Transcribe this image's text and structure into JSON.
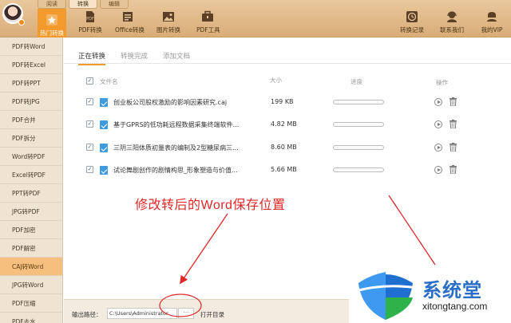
{
  "mode_tabs": [
    "阅读",
    "转换",
    "编辑"
  ],
  "toolbar": {
    "hot": "热门转换",
    "pdf": "PDF转换",
    "office": "Office转换",
    "image": "图片转换",
    "pdftools": "PDF工具",
    "history": "转换记录",
    "contact": "联系我们",
    "vip": "我的VIP"
  },
  "sidebar": [
    "PDF转Word",
    "PDF转Excel",
    "PDF转PPT",
    "PDF转JPG",
    "PDF合并",
    "PDF拆分",
    "Word转PDF",
    "Excel转PDF",
    "PPT转PDF",
    "JPG转PDF",
    "PDF加密",
    "PDF解密",
    "CAJ转Word",
    "JPG转Word",
    "PDF压缩",
    "PDF去水"
  ],
  "sidebar_active": "CAJ转Word",
  "subtabs": [
    "正在转换",
    "转换完成",
    "添加文档"
  ],
  "table": {
    "headers": {
      "name": "文件名",
      "size": "大小",
      "progress": "进度",
      "action": "操作"
    },
    "rows": [
      {
        "name": "创业板公司股权激励的影响因素研究.caj",
        "size": "199 KB",
        "progress": 0
      },
      {
        "name": "基于GPRS的低功耗远程数据采集终端软件...",
        "size": "4.82 MB",
        "progress": 0
      },
      {
        "name": "三阴三阳体质初量表的编制及2型糖尿病三...",
        "size": "8.60 MB",
        "progress": 0
      },
      {
        "name": "试论舞剧创作的剧情构思_形象塑造与价值...",
        "size": "5.66 MB",
        "progress": 0
      }
    ]
  },
  "bottom": {
    "output_label": "输出路径：",
    "output_path": "C:\\Users\\Administrator",
    "browse": "···",
    "open_dir": "打开目录"
  },
  "annotation": "修改转后的Word保存位置",
  "annotation_color": "#e02828",
  "accent_color": "#f39a2c",
  "watermark": {
    "title": "系统堂",
    "url": "xitongtang.com"
  }
}
